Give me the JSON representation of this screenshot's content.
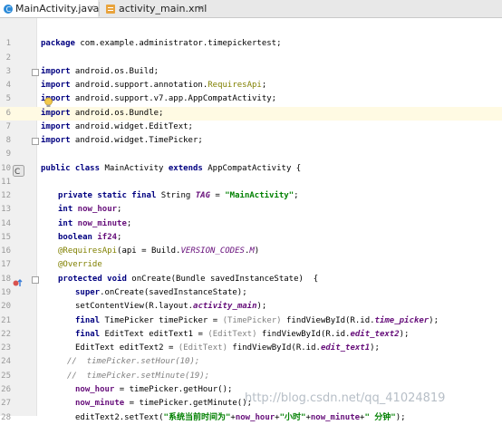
{
  "tabs": [
    {
      "label": "MainActivity.java",
      "close": "×",
      "icon": "java-class-icon",
      "active": true
    },
    {
      "label": "activity_main.xml",
      "close": "×",
      "icon": "xml-layout-icon",
      "active": false
    }
  ],
  "gutter": {
    "line_numbers": [
      "1",
      "2",
      "3",
      "4",
      "5",
      "6",
      "7",
      "8",
      "9",
      "10",
      "11",
      "12",
      "13",
      "14",
      "15",
      "16",
      "17",
      "18",
      "19",
      "20",
      "21",
      "22",
      "23",
      "24",
      "25",
      "26",
      "27",
      "28"
    ]
  },
  "code": {
    "l1": {
      "kw": "package",
      "rest": " com.example.administrator.timepickertest;"
    },
    "l3": {
      "kw": "import",
      "rest": " android.os.Build;"
    },
    "l4": {
      "kw": "import",
      "rest": " android.support.annotation.",
      "ann": "RequiresApi",
      "end": ";"
    },
    "l5": {
      "kw": "import",
      "rest": " android.support.v7.app.AppCompatActivity;"
    },
    "l6": {
      "kw": "import",
      "rest": " android.os.Bundle;"
    },
    "l7": {
      "kw": "import",
      "rest": " android.widget.EditText;"
    },
    "l8": {
      "kw": "import",
      "rest": " android.widget.TimePicker;"
    },
    "l10": {
      "kw": "public class",
      "name": " MainActivity ",
      "kw2": "extends",
      "rest": " AppCompatActivity {"
    },
    "l12": {
      "kw": "private static final",
      "mid": " String ",
      "field": "TAG",
      "eq": " = ",
      "str": "\"MainActivity\"",
      "end": ";"
    },
    "l13": {
      "kw": "int",
      "field": " now_hour",
      "end": ";"
    },
    "l14": {
      "kw": "int",
      "field": " now_minute",
      "end": ";"
    },
    "l15": {
      "kw": "boolean",
      "field": " if24",
      "end": ";"
    },
    "l16": {
      "ann": "@RequiresApi",
      "a": "(api = Build.",
      "sfield": "VERSION_CODES",
      "dot": ".",
      "ital": "M",
      "end": ")"
    },
    "l17": {
      "ann": "@Override"
    },
    "l18": {
      "kw": "protected void",
      "rest": " onCreate(Bundle savedInstanceState)  {"
    },
    "l19": {
      "kw": "super",
      "rest": ".onCreate(savedInstanceState);"
    },
    "l20": {
      "a": "setContentView(R.layout.",
      "ifield": "activity_main",
      "end": ");"
    },
    "l21": {
      "kw": "final",
      "a": " TimePicker timePicker = ",
      "cast": "(TimePicker)",
      "b": " findViewById(R.id.",
      "ifield": "time_picker",
      "end": ");"
    },
    "l22": {
      "kw": "final",
      "a": " EditText editText1 = ",
      "cast": "(EditText)",
      "b": " findViewById(R.id.",
      "ifield": "edit_text2",
      "end": ");"
    },
    "l23": {
      "a": "EditText editText2 = ",
      "cast": "(EditText)",
      "b": " findViewById(R.id.",
      "ifield": "edit_text1",
      "end": ");"
    },
    "l24": {
      "comment": "//  timePicker.setHour(10);"
    },
    "l25": {
      "comment": "//  timePicker.setMinute(19);"
    },
    "l26": {
      "field": "now_hour",
      "rest": " = timePicker.getHour();"
    },
    "l27": {
      "field": "now_minute",
      "rest": " = timePicker.getMinute();"
    },
    "l28": {
      "a": "editText2.setText(",
      "s1": "\"系统当前时间为\"",
      "p1": "+",
      "f1": "now_hour",
      "p2": "+",
      "s2": "\"小时\"",
      "p3": "+",
      "f2": "now_minute",
      "p4": "+",
      "s3": "\" 分钟\"",
      "end": ");"
    }
  },
  "watermark": "http://blog.csdn.net/qq_41024819"
}
